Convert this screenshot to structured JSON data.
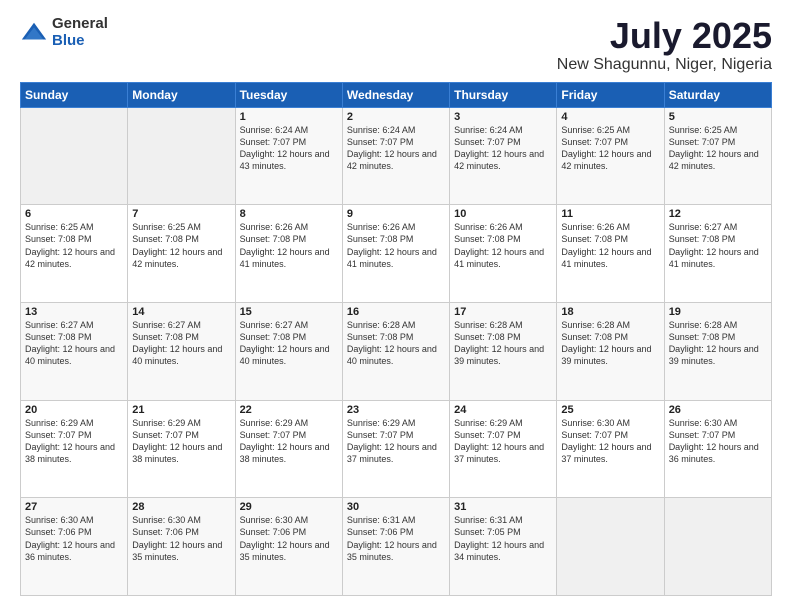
{
  "logo": {
    "general": "General",
    "blue": "Blue"
  },
  "header": {
    "month": "July 2025",
    "location": "New Shagunnu, Niger, Nigeria"
  },
  "days_of_week": [
    "Sunday",
    "Monday",
    "Tuesday",
    "Wednesday",
    "Thursday",
    "Friday",
    "Saturday"
  ],
  "weeks": [
    [
      {
        "day": "",
        "info": ""
      },
      {
        "day": "",
        "info": ""
      },
      {
        "day": "1",
        "info": "Sunrise: 6:24 AM\nSunset: 7:07 PM\nDaylight: 12 hours and 43 minutes."
      },
      {
        "day": "2",
        "info": "Sunrise: 6:24 AM\nSunset: 7:07 PM\nDaylight: 12 hours and 42 minutes."
      },
      {
        "day": "3",
        "info": "Sunrise: 6:24 AM\nSunset: 7:07 PM\nDaylight: 12 hours and 42 minutes."
      },
      {
        "day": "4",
        "info": "Sunrise: 6:25 AM\nSunset: 7:07 PM\nDaylight: 12 hours and 42 minutes."
      },
      {
        "day": "5",
        "info": "Sunrise: 6:25 AM\nSunset: 7:07 PM\nDaylight: 12 hours and 42 minutes."
      }
    ],
    [
      {
        "day": "6",
        "info": "Sunrise: 6:25 AM\nSunset: 7:08 PM\nDaylight: 12 hours and 42 minutes."
      },
      {
        "day": "7",
        "info": "Sunrise: 6:25 AM\nSunset: 7:08 PM\nDaylight: 12 hours and 42 minutes."
      },
      {
        "day": "8",
        "info": "Sunrise: 6:26 AM\nSunset: 7:08 PM\nDaylight: 12 hours and 41 minutes."
      },
      {
        "day": "9",
        "info": "Sunrise: 6:26 AM\nSunset: 7:08 PM\nDaylight: 12 hours and 41 minutes."
      },
      {
        "day": "10",
        "info": "Sunrise: 6:26 AM\nSunset: 7:08 PM\nDaylight: 12 hours and 41 minutes."
      },
      {
        "day": "11",
        "info": "Sunrise: 6:26 AM\nSunset: 7:08 PM\nDaylight: 12 hours and 41 minutes."
      },
      {
        "day": "12",
        "info": "Sunrise: 6:27 AM\nSunset: 7:08 PM\nDaylight: 12 hours and 41 minutes."
      }
    ],
    [
      {
        "day": "13",
        "info": "Sunrise: 6:27 AM\nSunset: 7:08 PM\nDaylight: 12 hours and 40 minutes."
      },
      {
        "day": "14",
        "info": "Sunrise: 6:27 AM\nSunset: 7:08 PM\nDaylight: 12 hours and 40 minutes."
      },
      {
        "day": "15",
        "info": "Sunrise: 6:27 AM\nSunset: 7:08 PM\nDaylight: 12 hours and 40 minutes."
      },
      {
        "day": "16",
        "info": "Sunrise: 6:28 AM\nSunset: 7:08 PM\nDaylight: 12 hours and 40 minutes."
      },
      {
        "day": "17",
        "info": "Sunrise: 6:28 AM\nSunset: 7:08 PM\nDaylight: 12 hours and 39 minutes."
      },
      {
        "day": "18",
        "info": "Sunrise: 6:28 AM\nSunset: 7:08 PM\nDaylight: 12 hours and 39 minutes."
      },
      {
        "day": "19",
        "info": "Sunrise: 6:28 AM\nSunset: 7:08 PM\nDaylight: 12 hours and 39 minutes."
      }
    ],
    [
      {
        "day": "20",
        "info": "Sunrise: 6:29 AM\nSunset: 7:07 PM\nDaylight: 12 hours and 38 minutes."
      },
      {
        "day": "21",
        "info": "Sunrise: 6:29 AM\nSunset: 7:07 PM\nDaylight: 12 hours and 38 minutes."
      },
      {
        "day": "22",
        "info": "Sunrise: 6:29 AM\nSunset: 7:07 PM\nDaylight: 12 hours and 38 minutes."
      },
      {
        "day": "23",
        "info": "Sunrise: 6:29 AM\nSunset: 7:07 PM\nDaylight: 12 hours and 37 minutes."
      },
      {
        "day": "24",
        "info": "Sunrise: 6:29 AM\nSunset: 7:07 PM\nDaylight: 12 hours and 37 minutes."
      },
      {
        "day": "25",
        "info": "Sunrise: 6:30 AM\nSunset: 7:07 PM\nDaylight: 12 hours and 37 minutes."
      },
      {
        "day": "26",
        "info": "Sunrise: 6:30 AM\nSunset: 7:07 PM\nDaylight: 12 hours and 36 minutes."
      }
    ],
    [
      {
        "day": "27",
        "info": "Sunrise: 6:30 AM\nSunset: 7:06 PM\nDaylight: 12 hours and 36 minutes."
      },
      {
        "day": "28",
        "info": "Sunrise: 6:30 AM\nSunset: 7:06 PM\nDaylight: 12 hours and 35 minutes."
      },
      {
        "day": "29",
        "info": "Sunrise: 6:30 AM\nSunset: 7:06 PM\nDaylight: 12 hours and 35 minutes."
      },
      {
        "day": "30",
        "info": "Sunrise: 6:31 AM\nSunset: 7:06 PM\nDaylight: 12 hours and 35 minutes."
      },
      {
        "day": "31",
        "info": "Sunrise: 6:31 AM\nSunset: 7:05 PM\nDaylight: 12 hours and 34 minutes."
      },
      {
        "day": "",
        "info": ""
      },
      {
        "day": "",
        "info": ""
      }
    ]
  ]
}
